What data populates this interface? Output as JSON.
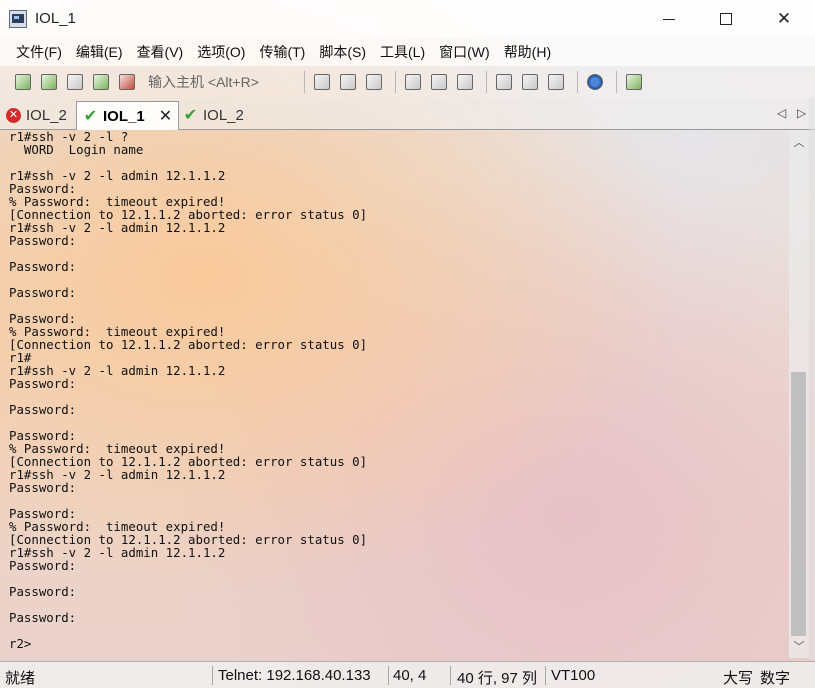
{
  "window": {
    "title": "IOL_1",
    "icon": "terminal-app-icon"
  },
  "menu": [
    "文件(F)",
    "编辑(E)",
    "查看(V)",
    "选项(O)",
    "传输(T)",
    "脚本(S)",
    "工具(L)",
    "窗口(W)",
    "帮助(H)"
  ],
  "toolbar": {
    "host_placeholder": "输入主机 <Alt+R>",
    "icons_left": [
      "connect-icon",
      "quick-connect-icon",
      "connect-in-tab-icon",
      "reconnect-icon",
      "disconnect-icon"
    ],
    "icons_right": [
      "copy-icon",
      "paste-icon",
      "find-icon",
      "print-setup-icon",
      "print-selection-icon",
      "print-icon",
      "session-options-icon",
      "global-options-icon",
      "key-icon",
      "help-icon",
      "map-icon"
    ]
  },
  "tabs": [
    {
      "label": "IOL_2",
      "status": "error"
    },
    {
      "label": "IOL_1",
      "status": "ok",
      "active": true
    },
    {
      "label": "IOL_2",
      "status": "ok"
    }
  ],
  "terminal": {
    "lines": [
      "r1#ssh -v 2 -l ?",
      "  WORD  Login name",
      "",
      "r1#ssh -v 2 -l admin 12.1.1.2",
      "Password:",
      "% Password:  timeout expired!",
      "[Connection to 12.1.1.2 aborted: error status 0]",
      "r1#ssh -v 2 -l admin 12.1.1.2",
      "Password:",
      "",
      "Password:",
      "",
      "Password:",
      "",
      "Password:",
      "% Password:  timeout expired!",
      "[Connection to 12.1.1.2 aborted: error status 0]",
      "r1#",
      "r1#ssh -v 2 -l admin 12.1.1.2",
      "Password:",
      "",
      "Password:",
      "",
      "Password:",
      "% Password:  timeout expired!",
      "[Connection to 12.1.1.2 aborted: error status 0]",
      "r1#ssh -v 2 -l admin 12.1.1.2",
      "Password:",
      "",
      "Password:",
      "% Password:  timeout expired!",
      "[Connection to 12.1.1.2 aborted: error status 0]",
      "r1#ssh -v 2 -l admin 12.1.1.2",
      "Password:",
      "",
      "Password:",
      "",
      "Password:",
      "",
      "r2>"
    ]
  },
  "statusbar": {
    "ready": "就绪",
    "connection": "Telnet: 192.168.40.133",
    "cursor": "40,  4",
    "size": "40 行, 97 列",
    "emulation": "VT100",
    "caps": "大写",
    "num": "数字"
  }
}
